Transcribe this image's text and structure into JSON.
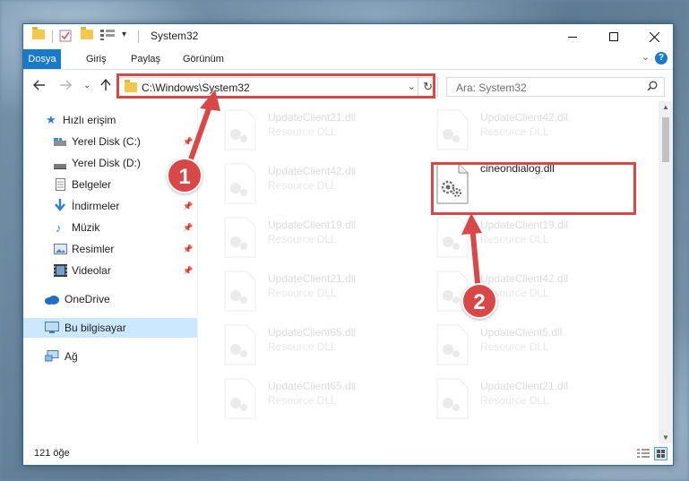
{
  "window": {
    "title": "System32",
    "quick_access_icons": [
      "folder-icon",
      "properties-icon",
      "new-folder-icon",
      "view-options-icon"
    ],
    "controls": [
      "minimize",
      "maximize",
      "close"
    ]
  },
  "ribbon": {
    "tabs": [
      {
        "label": "Dosya",
        "active": true
      },
      {
        "label": "Giriş",
        "active": false
      },
      {
        "label": "Paylaş",
        "active": false
      },
      {
        "label": "Görünüm",
        "active": false
      }
    ],
    "help": "?"
  },
  "address_bar": {
    "path": "C:\\Windows\\System32",
    "search_placeholder": "Ara: System32"
  },
  "sidebar": {
    "items": [
      {
        "label": "Hızlı erişim",
        "icon": "star-icon",
        "pinned": false
      },
      {
        "label": "Yerel Disk (C:)",
        "icon": "drive-icon",
        "pinned": true
      },
      {
        "label": "Yerel Disk (D:)",
        "icon": "drive-icon",
        "pinned": true
      },
      {
        "label": "Belgeler",
        "icon": "documents-icon",
        "pinned": true
      },
      {
        "label": "İndirmeler",
        "icon": "download-icon",
        "pinned": true
      },
      {
        "label": "Müzik",
        "icon": "music-icon",
        "pinned": true
      },
      {
        "label": "Resimler",
        "icon": "pictures-icon",
        "pinned": true
      },
      {
        "label": "Videolar",
        "icon": "videos-icon",
        "pinned": true
      },
      {
        "label": "OneDrive",
        "icon": "cloud-icon",
        "pinned": false
      },
      {
        "label": "Bu bilgisayar",
        "icon": "computer-icon",
        "pinned": false,
        "selected": true
      },
      {
        "label": "Ağ",
        "icon": "network-icon",
        "pinned": false
      }
    ]
  },
  "files": {
    "left_column": [
      {
        "name": "UpdateClient21.dll",
        "type": "Resource DLL"
      },
      {
        "name": "UpdateClient42.dll",
        "type": "Resource DLL"
      },
      {
        "name": "UpdateClient19.dll",
        "type": "Resource DLL"
      },
      {
        "name": "UpdateClient21.dll",
        "type": "Resource DLL"
      },
      {
        "name": "UpdateClient65.dll",
        "type": "Resource DLL"
      },
      {
        "name": "UpdateClient65.dll",
        "type": "Resource DLL"
      }
    ],
    "right_column": [
      {
        "name": "UpdateClient42.dll",
        "type": "Resource DLL"
      },
      {
        "name": "cineondialog.dll",
        "type": "",
        "highlighted": true
      },
      {
        "name": "UpdateClient19.dll",
        "type": "Resource DLL"
      },
      {
        "name": "UpdateClient42.dll",
        "type": "Resource DLL"
      },
      {
        "name": "UpdateClient5.dll",
        "type": "Resource DLL"
      },
      {
        "name": "UpdateClient21.dll",
        "type": "Resource DLL"
      }
    ]
  },
  "status": {
    "item_count": "121 öğe"
  },
  "annotations": {
    "step1": "1",
    "step2": "2",
    "color": "#d94848"
  }
}
